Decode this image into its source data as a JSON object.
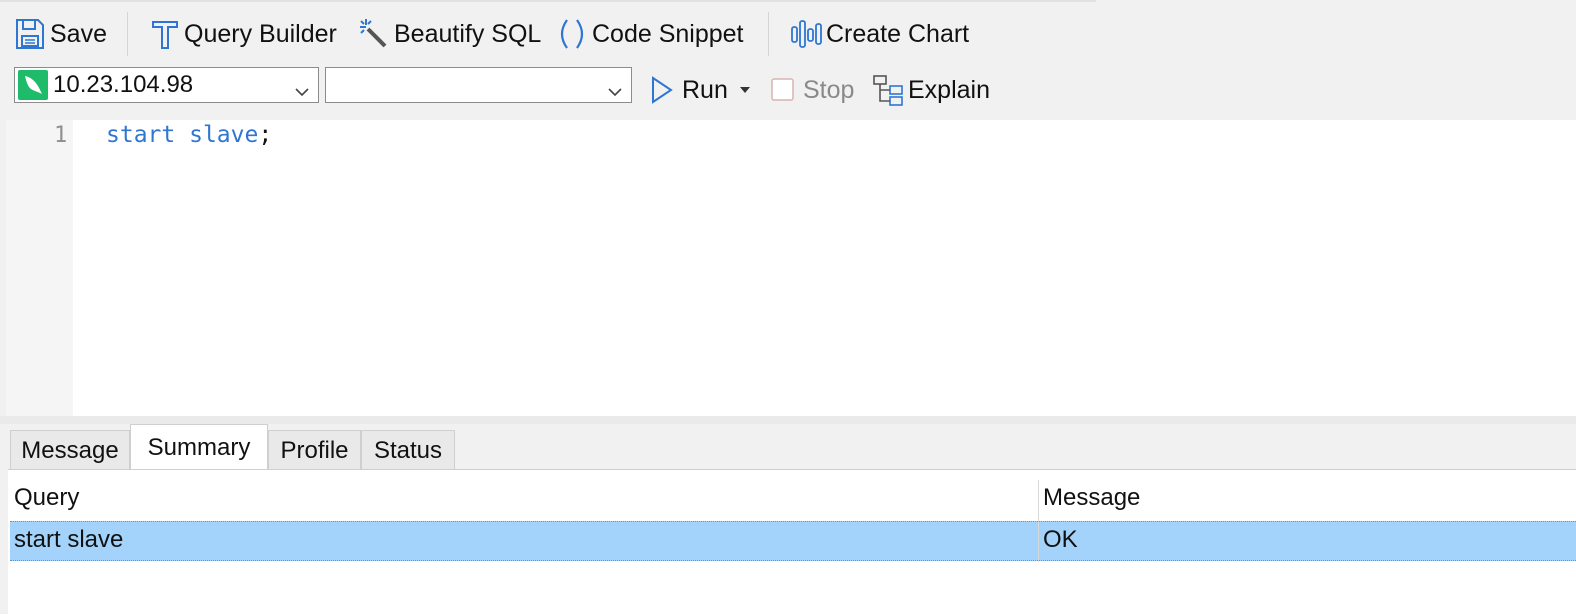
{
  "toolbar": {
    "save_label": "Save",
    "query_builder_label": "Query Builder",
    "beautify_label": "Beautify SQL",
    "snippet_label": "Code Snippet",
    "chart_label": "Create Chart"
  },
  "connection": {
    "selected": "10.23.104.98",
    "database_selected": ""
  },
  "actions": {
    "run_label": "Run",
    "stop_label": "Stop",
    "explain_label": "Explain"
  },
  "editor": {
    "line_number": "1",
    "tokens": [
      "start",
      "slave",
      ";"
    ]
  },
  "results": {
    "tabs": [
      "Message",
      "Summary",
      "Profile",
      "Status"
    ],
    "active_tab": "Summary",
    "columns": [
      "Query",
      "Message"
    ],
    "rows": [
      {
        "query": "start slave",
        "message": "OK"
      }
    ]
  },
  "colors": {
    "accent": "#2f76d2",
    "selected_row": "#a3d3fb",
    "connection_icon": "#1dbb6a"
  }
}
